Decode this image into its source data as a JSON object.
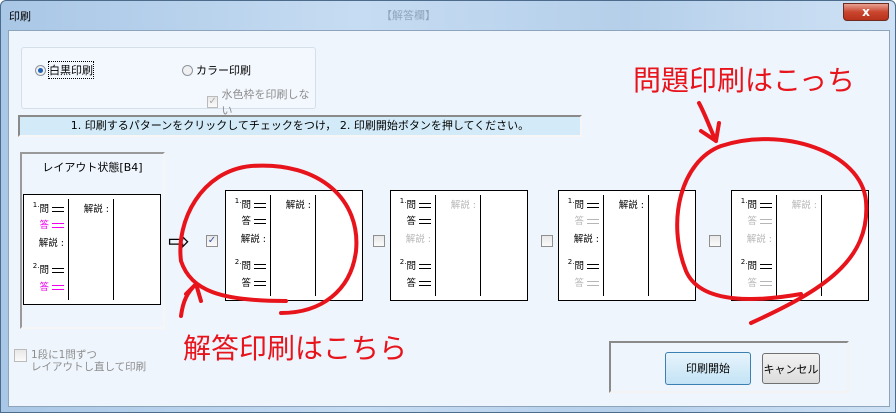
{
  "window": {
    "title": "印刷",
    "background_title": "【解答欄】",
    "close_label": "x"
  },
  "print_mode": {
    "mono_label": "白黒印刷",
    "color_label": "カラー印刷",
    "selected": "mono",
    "no_frame_label": "水色枠を印刷しない",
    "no_frame_checked": true
  },
  "instruction": "1. 印刷するパターンをクリックしてチェックをつけ， 2. 印刷開始ボタンを押してください。",
  "current_layout": {
    "title": "レイアウト状態[B4]"
  },
  "labels": {
    "q1": "1.",
    "q2": "2.",
    "question": "問",
    "answer": "答",
    "explanation": "解説",
    "colon": ":"
  },
  "patterns": [
    {
      "checked": true,
      "states": {
        "a1": "k",
        "e_left": "k",
        "a2": "k",
        "e_mid": "k"
      }
    },
    {
      "checked": false,
      "states": {
        "a1": "k",
        "e_left": "g",
        "a2": "k",
        "e_mid": "g"
      }
    },
    {
      "checked": false,
      "states": {
        "a1": "g",
        "e_left": "k",
        "a2": "g",
        "e_mid": "k"
      }
    },
    {
      "checked": false,
      "states": {
        "a1": "g",
        "e_left": "g",
        "a2": "g",
        "e_mid": "g"
      }
    }
  ],
  "relayout": {
    "label_line1": "1段に1問ずつ",
    "label_line2": "レイアウトし直して印刷",
    "checked": false
  },
  "buttons": {
    "start": "印刷開始",
    "cancel": "キャンセル"
  },
  "annotations": {
    "answer_print": "解答印刷はこちら",
    "question_print": "問題印刷はこっち",
    "color": "#e8141c"
  }
}
